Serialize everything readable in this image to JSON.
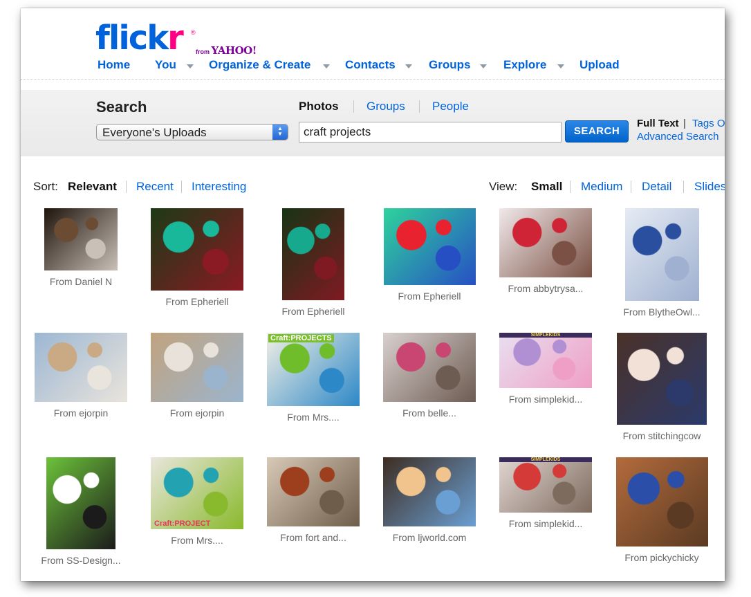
{
  "header": {
    "logo_flick": "flick",
    "logo_r": "r",
    "logo_reg": "®",
    "logo_from": "from",
    "logo_yahoo": "YAHOO!"
  },
  "nav": {
    "home": "Home",
    "you": "You",
    "organize": "Organize & Create",
    "contacts": "Contacts",
    "groups": "Groups",
    "explore": "Explore",
    "upload": "Upload"
  },
  "search": {
    "title": "Search",
    "scope_selected": "Everyone's Uploads",
    "tabs": {
      "photos": "Photos",
      "groups": "Groups",
      "people": "People"
    },
    "query": "craft projects",
    "button": "SEARCH",
    "full_text": "Full Text",
    "separator": "|",
    "tags_only": "Tags O",
    "advanced": "Advanced Search"
  },
  "sort": {
    "label": "Sort:",
    "relevant": "Relevant",
    "recent": "Recent",
    "interesting": "Interesting"
  },
  "view": {
    "label": "View:",
    "small": "Small",
    "medium": "Medium",
    "detail": "Detail",
    "slides": "Slides"
  },
  "photos": [
    {
      "caption": "From Daniel N",
      "colors": [
        "#1f140c",
        "#6b4c33",
        "#c9c0b8"
      ]
    },
    {
      "caption": "From Epheriell",
      "colors": [
        "#1c3a16",
        "#19b89a",
        "#8a1a24"
      ]
    },
    {
      "caption": "From Epheriell",
      "colors": [
        "#173414",
        "#16a98d",
        "#7f1a22"
      ]
    },
    {
      "caption": "From Epheriell",
      "colors": [
        "#2ed39c",
        "#e8232f",
        "#274fc4"
      ]
    },
    {
      "caption": "From abbytrysa...",
      "colors": [
        "#f1e8ea",
        "#cf2436",
        "#7a5144"
      ]
    },
    {
      "caption": "From BlytheOwl...",
      "colors": [
        "#e5ebf4",
        "#2a4f9e",
        "#9fb0d0"
      ]
    },
    {
      "caption": "From ejorpin",
      "colors": [
        "#9cb7d3",
        "#c9aa84",
        "#e9e4dc"
      ]
    },
    {
      "caption": "From ejorpin",
      "colors": [
        "#c1a37f",
        "#e8e2da",
        "#9bb4cd"
      ]
    },
    {
      "caption": "From Mrs....",
      "colors": [
        "#f2efe5",
        "#6fbd2a",
        "#2c88c7"
      ],
      "mark": "Craft:PROJECTS"
    },
    {
      "caption": "From belle...",
      "colors": [
        "#d9d0ce",
        "#c94572",
        "#6d5c52"
      ]
    },
    {
      "caption": "From simplekid...",
      "colors": [
        "#e8dff0",
        "#b18fd3",
        "#ef9fc5"
      ],
      "mark": "SIMPLEKIDS"
    },
    {
      "caption": "From stitchingcow",
      "colors": [
        "#4a3128",
        "#f1e1d6",
        "#2b3a6b"
      ]
    },
    {
      "caption": "From SS-Design...",
      "colors": [
        "#6cc23a",
        "#ffffff",
        "#1b1b1b"
      ]
    },
    {
      "caption": "From Mrs....",
      "colors": [
        "#e9e6dc",
        "#23a3b1",
        "#89b92c"
      ],
      "mark": "Craft:PROJECT"
    },
    {
      "caption": "From fort and...",
      "colors": [
        "#d8c9b6",
        "#9d3e1c",
        "#6f5d4c"
      ]
    },
    {
      "caption": "From ljworld.com",
      "colors": [
        "#3e2d22",
        "#f2c48d",
        "#6a9fd3"
      ]
    },
    {
      "caption": "From simplekid...",
      "colors": [
        "#e2d6d2",
        "#d43a37",
        "#7d6b5e"
      ],
      "mark": "SIMPLEKIDS"
    },
    {
      "caption": "From pickychicky",
      "colors": [
        "#b36b3c",
        "#2b4fa8",
        "#5a3a22"
      ]
    }
  ]
}
